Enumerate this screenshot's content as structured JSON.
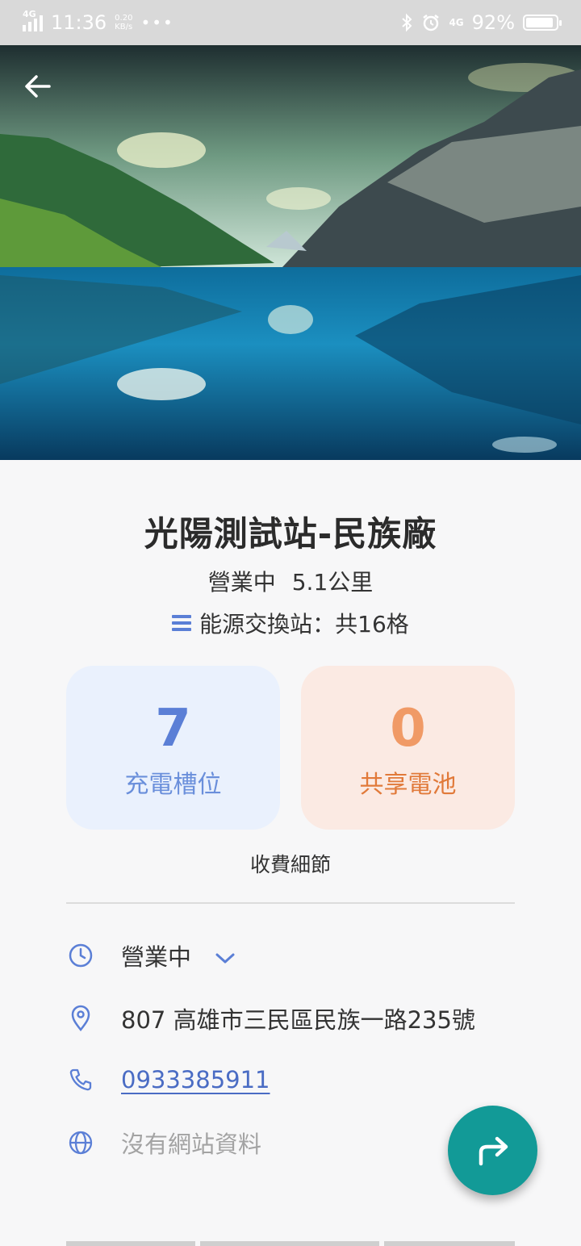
{
  "status_bar": {
    "network": "4G",
    "time": "11:36",
    "speed_value": "0.20",
    "speed_unit": "KB/s",
    "more": "•••",
    "network_right": "4G",
    "battery_percent": "92%",
    "battery_level": 0.92
  },
  "hero": {
    "back_icon": "arrow-left-icon"
  },
  "station": {
    "name": "光陽測試站-民族廠",
    "status": "營業中",
    "distance": "5.1公里",
    "type_line": "能源交換站：共16格"
  },
  "cards": {
    "charging_slots": {
      "value": "7",
      "label": "充電槽位",
      "color": "#5b7fd6"
    },
    "shared_batteries": {
      "value": "0",
      "label": "共享電池",
      "color": "#e17a3a"
    }
  },
  "fee_details": "收費細節",
  "info": {
    "hours": "營業中",
    "address": "807 高雄市三民區民族一路235號",
    "phone": "0933385911",
    "website": "沒有網站資料"
  },
  "colors": {
    "accent": "#5b7fd6",
    "fab": "#129a97"
  },
  "fab_icon": "navigate-arrow-icon"
}
